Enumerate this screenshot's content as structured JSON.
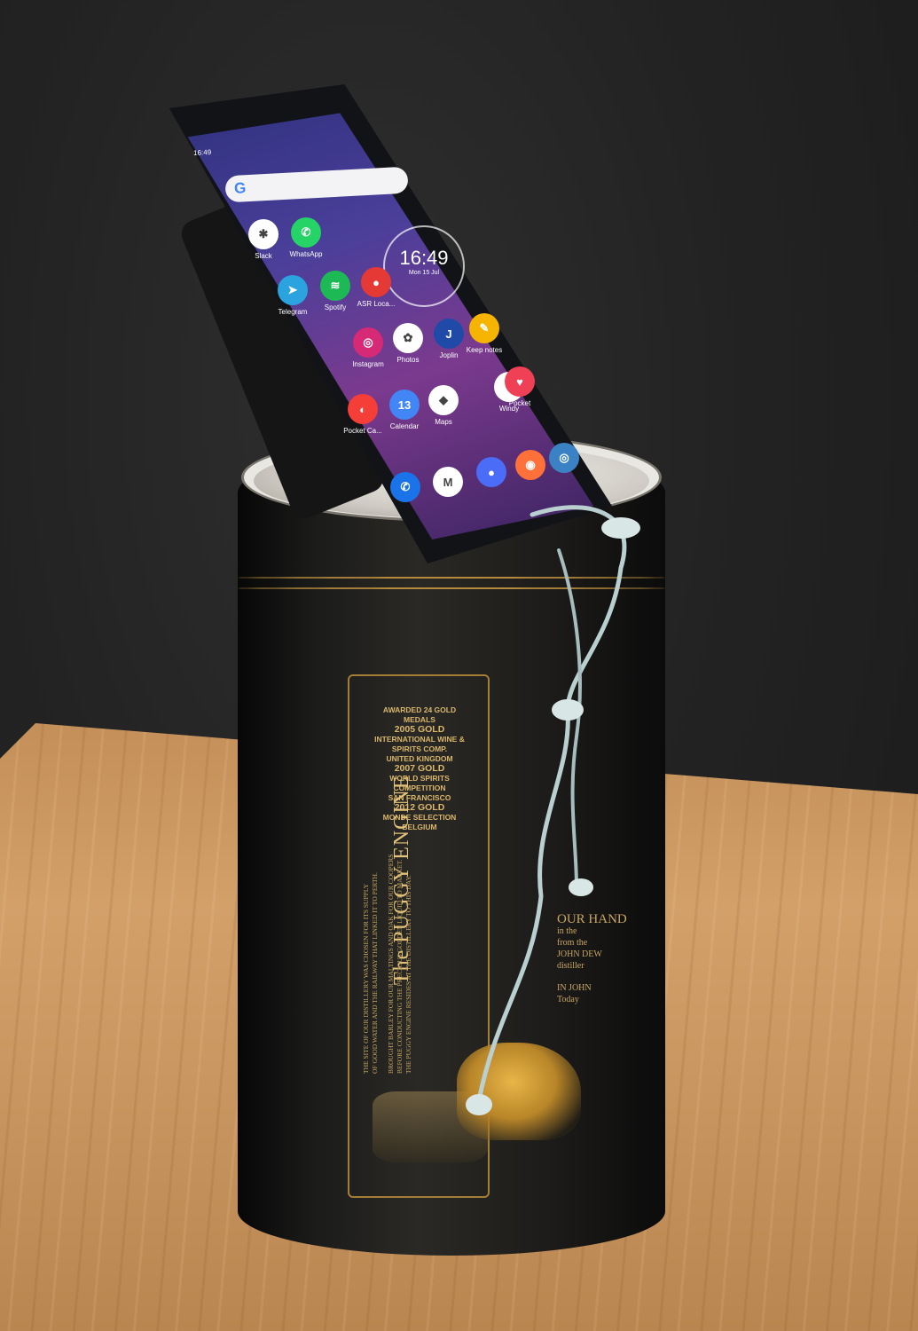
{
  "phone": {
    "status_time": "16:49",
    "search_letter": "G",
    "clock_time": "16:49",
    "clock_date": "Mon 15 Jul",
    "apps": [
      {
        "label": "Slack",
        "color": "#ffffff",
        "glyph": "✱"
      },
      {
        "label": "WhatsApp",
        "color": "#25d366",
        "glyph": "✆"
      },
      {
        "label": "Telegram",
        "color": "#2aa3df",
        "glyph": "➤"
      },
      {
        "label": "Spotify",
        "color": "#1db954",
        "glyph": "≋"
      },
      {
        "label": "ASR Loca...",
        "color": "#e53935",
        "glyph": "●"
      },
      {
        "label": "Instagram",
        "color": "#d62976",
        "glyph": "◎"
      },
      {
        "label": "Photos",
        "color": "#ffffff",
        "glyph": "✿"
      },
      {
        "label": "Joplin",
        "color": "#1f4aa8",
        "glyph": "J"
      },
      {
        "label": "Keep notes",
        "color": "#f4b400",
        "glyph": "✎"
      },
      {
        "label": "Pocket Ca...",
        "color": "#f43e37",
        "glyph": "◐"
      },
      {
        "label": "Calendar",
        "color": "#4285f4",
        "glyph": "13"
      },
      {
        "label": "Maps",
        "color": "#ffffff",
        "glyph": "◆"
      },
      {
        "label": "Windy",
        "color": "#ffffff",
        "glyph": "V"
      },
      {
        "label": "Pocket",
        "color": "#ef4056",
        "glyph": "♥"
      },
      {
        "label": "",
        "color": "#1a73e8",
        "glyph": "✆"
      },
      {
        "label": "",
        "color": "#ffffff",
        "glyph": "M"
      },
      {
        "label": "",
        "color": "#4a6cf7",
        "glyph": "●"
      },
      {
        "label": "",
        "color": "#ff7139",
        "glyph": "◉"
      },
      {
        "label": "",
        "color": "#3b82c4",
        "glyph": "◎"
      }
    ]
  },
  "tube": {
    "awards_heading": "AWARDED 24 GOLD MEDALS",
    "award1_title": "2005 GOLD",
    "award1_line1": "INTERNATIONAL WINE & SPIRITS COMP.",
    "award1_line2": "UNITED KINGDOM",
    "award2_title": "2007 GOLD",
    "award2_line1": "WORLD SPIRITS COMPETITION",
    "award2_line2": "SAN FRANCISCO",
    "award3_title": "2012 GOLD",
    "award3_line1": "MONDE SELECTION",
    "award3_line2": "BELGIUM",
    "panel_title": "The PUGGY ENGINE",
    "panel_text_1": "THE SITE OF OUR DISTILLERY WAS CHOSEN FOR ITS SUPPLY",
    "panel_text_2": "OF GOOD WATER AND THE RAILWAY THAT LINKED IT TO PERTH.",
    "panel_text_3": "BROUGHT BARLEY FOR OUR MALTINGS AND OAK FOR OUR COOPERS",
    "panel_text_4": "BEFORE CONDUCTING THE PRECIOUS GOLDEN LIQUID TO MARKET.",
    "panel_text_5": "THE PUGGY ENGINE RESIDES AT THE DISTILLERY TO THIS DAY.",
    "side_line1": "OUR HAND",
    "side_line2": "in the",
    "side_line3": "from the",
    "side_line4": "JOHN DEW",
    "side_line5": "distiller",
    "side_line6": "IN JOHN",
    "side_line7": "Today"
  }
}
